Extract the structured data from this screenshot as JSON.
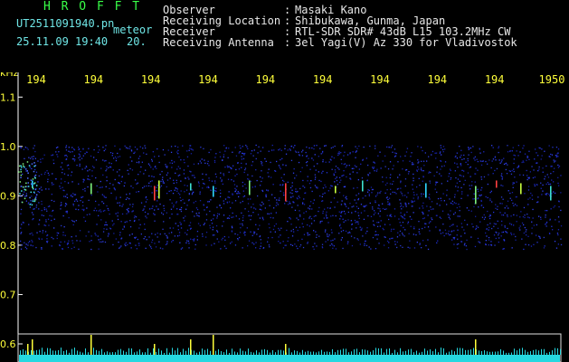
{
  "app": {
    "name": "H R O F F T",
    "filename": "UT2511091940.pn",
    "mode": "meteor",
    "datetime": "25.11.09 19:40",
    "interval": "20."
  },
  "header": {
    "rows": [
      {
        "label": "Observer",
        "value": "Masaki Kano"
      },
      {
        "label": "Receiving Location",
        "value": "Shibukawa, Gunma, Japan"
      },
      {
        "label": "Receiver",
        "value": "RTL-SDR SDR# 43dB L15 103.2MHz CW"
      },
      {
        "label": "Receiving Antenna",
        "value": "3el Yagi(V) Az 330 for Vladivostok"
      }
    ],
    "colon": ":"
  },
  "chart_data": {
    "type": "heatmap",
    "y_unit_label": "kHz",
    "y_ticks": [
      "1.1",
      "1.0",
      "0.9",
      "0.8",
      "0.7",
      "0.6"
    ],
    "x_ticks": [
      "194",
      "194",
      "194",
      "194",
      "194",
      "194",
      "194",
      "194",
      "194",
      "1950"
    ],
    "ylim": [
      0.6,
      1.15
    ],
    "signal_band": [
      0.8,
      1.0
    ],
    "colors": {
      "background": "#000000",
      "noise": "#1c2bd8",
      "axis": "#ffffff",
      "tick_labels": "#ffff3a",
      "bottom_trace": "#25d8e0"
    }
  }
}
